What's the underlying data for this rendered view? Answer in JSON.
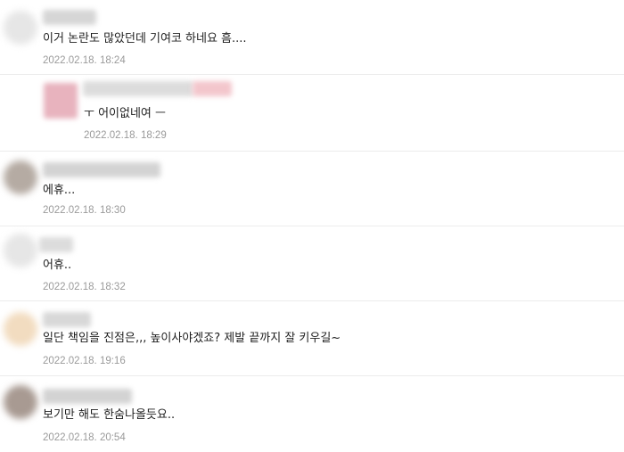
{
  "comments": [
    {
      "text": "이거 논란도 많았던데 기여코 하네요 흠....",
      "date": "2022.02.18. 18:24",
      "avatar_color": "#e6e6e6",
      "name_color": "#d6d6d6"
    },
    {
      "text": "ㅜ 어이없네여 ㅡ",
      "date": "2022.02.18. 18:29",
      "avatar_color": "#e8b3be",
      "name_color": "#dcdcdc",
      "name_accent_color": "#f3c6cc"
    },
    {
      "text": "에휴...",
      "date": "2022.02.18. 18:30",
      "avatar_color": "#b5aba3",
      "name_color": "#d3d3d3"
    },
    {
      "text": "어휴..",
      "date": "2022.02.18. 18:32",
      "avatar_color": "#e6e6e6",
      "name_color": "#dcdcdc"
    },
    {
      "text": "일단 책임을 진점은,,, 높이사야겠죠? 제발 끝까지 잘 키우길~",
      "date": "2022.02.18. 19:16",
      "avatar_color": "#f2dcc0",
      "name_color": "#d8d8d8"
    },
    {
      "text": "보기만 해도 한숨나올듯요..",
      "date": "2022.02.18. 20:54",
      "avatar_color": "#a89a92",
      "name_color": "#d3d3d3"
    }
  ]
}
